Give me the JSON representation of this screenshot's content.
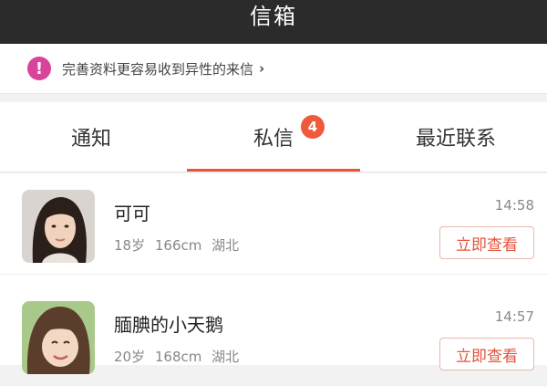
{
  "header": {
    "title": "信箱"
  },
  "notice": {
    "text": "完善资料更容易收到异性的来信",
    "icon": "exclamation-icon",
    "chevron": "›"
  },
  "tabs": [
    {
      "label": "通知"
    },
    {
      "label": "私信",
      "badge": "4",
      "active": true
    },
    {
      "label": "最近联系"
    }
  ],
  "messages": [
    {
      "name": "可可",
      "age": "18岁",
      "height": "166cm",
      "region": "湖北",
      "time": "14:58",
      "action": "立即查看"
    },
    {
      "name": "腼腆的小天鹅",
      "age": "20岁",
      "height": "168cm",
      "region": "湖北",
      "time": "14:57",
      "action": "立即查看"
    }
  ],
  "colors": {
    "accent": "#e8543a",
    "header_bg": "#2b2b2b",
    "notice_icon": "#d9439b"
  }
}
